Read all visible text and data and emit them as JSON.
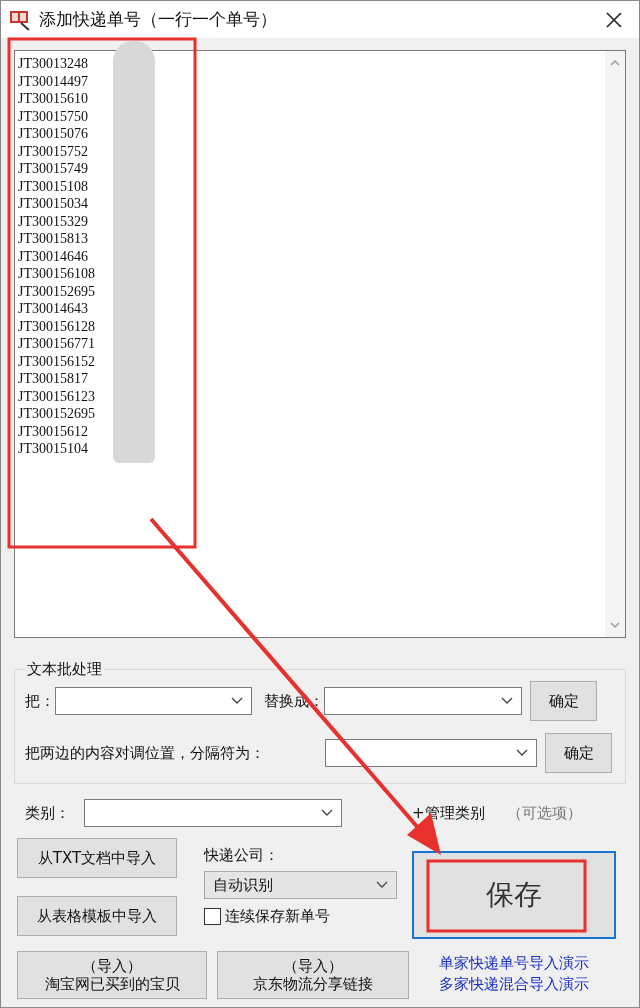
{
  "window": {
    "title": "添加快递单号（一行一个单号）"
  },
  "tracking_numbers": [
    "JT30013248",
    "JT30014497",
    "JT30015610",
    "JT30015750",
    "JT30015076",
    "JT30015752",
    "JT30015749",
    "JT30015108",
    "JT30015034",
    "JT30015329",
    "JT30015813",
    "JT30014646",
    "JT300156108",
    "JT300152695",
    "JT30014643",
    "JT300156128",
    "JT300156771",
    "JT300156152",
    "JT30015817",
    "JT300156123",
    "JT300152695",
    "JT30015612",
    "JT30015104"
  ],
  "batch": {
    "title": "文本批处理",
    "replace_label": "把：",
    "replace_with_label": "替换成：",
    "replace_confirm": "确定",
    "swap_label": "把两边的内容对调位置，分隔符为：",
    "swap_confirm": "确定"
  },
  "category": {
    "label": "类别：",
    "manage": "+管理类别",
    "optional": "（可选项）"
  },
  "import_buttons": [
    "从TXT文档中导入",
    "从表格模板中导入"
  ],
  "courier": {
    "label": "快递公司：",
    "value": "自动识别"
  },
  "continuous_save": {
    "label": "连续保存新单号",
    "checked": false
  },
  "save_button": "保存",
  "bottom_buttons": [
    {
      "line1": "（导入）",
      "line2": "淘宝网已买到的宝贝"
    },
    {
      "line1": "（导入）",
      "line2": "京东物流分享链接"
    }
  ],
  "demo_links": [
    "单家快递单号导入演示",
    "多家快递混合导入演示"
  ]
}
